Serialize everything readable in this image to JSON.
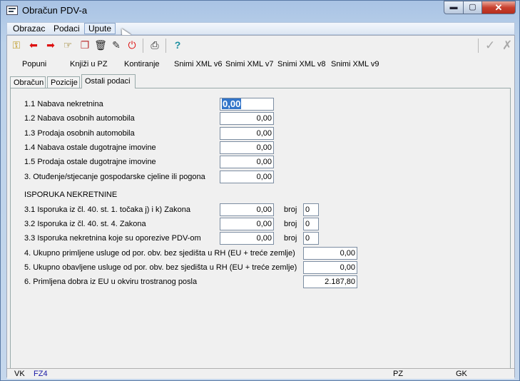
{
  "window": {
    "title": "Obračun PDV-a",
    "min_label": "▬",
    "max_label": "▢",
    "close_label": "✕"
  },
  "menu": {
    "items": [
      "Obrazac",
      "Podaci",
      "Upute"
    ]
  },
  "toolbar": {
    "icons": [
      "key-icon",
      "arrow-left-icon",
      "arrow-right-icon",
      "hand-point-icon",
      "copy-icon",
      "trash-icon",
      "edit-icon",
      "stop-icon",
      "print-icon",
      "help-icon"
    ],
    "help_label": "?"
  },
  "actions": {
    "popuni": "Popuni",
    "knjizi": "Knjiži u PZ",
    "kontiranje": "Kontiranje",
    "xml6": "Snimi XML v6",
    "xml7": "Snimi XML v7",
    "xml8": "Snimi XML v8",
    "xml9": "Snimi XML v9"
  },
  "tabs": [
    "Obračun",
    "Pozicije",
    "Ostali podaci"
  ],
  "form": {
    "r11": {
      "label": "1.1 Nabava nekretnina",
      "value": "0,00"
    },
    "r12": {
      "label": "1.2 Nabava osobnih automobila",
      "value": "0,00"
    },
    "r13": {
      "label": "1.3 Prodaja osobnih automobila",
      "value": "0,00"
    },
    "r14": {
      "label": "1.4 Nabava ostale dugotrajne imovine",
      "value": "0,00"
    },
    "r15": {
      "label": "1.5 Prodaja ostale dugotrajne imovine",
      "value": "0,00"
    },
    "r3": {
      "label": "3. Otuđenje/stjecanje gospodarske cjeline ili pogona",
      "value": "0,00"
    },
    "section": "ISPORUKA NEKRETNINE",
    "r31": {
      "label": "3.1 Isporuka iz čl. 40. st. 1. točaka j) i k) Zakona",
      "value": "0,00",
      "broj_label": "broj",
      "broj": "0"
    },
    "r32": {
      "label": "3.2 Isporuka iz čl. 40. st. 4. Zakona",
      "value": "0,00",
      "broj_label": "broj",
      "broj": "0"
    },
    "r33": {
      "label": "3.3 Isporuka nekretnina koje su oporezive PDV-om",
      "value": "0,00",
      "broj_label": "broj",
      "broj": "0"
    },
    "r4": {
      "label": "4. Ukupno primljene usluge od por. obv. bez sjedišta u RH (EU + treće zemlje)",
      "value": "0,00"
    },
    "r5": {
      "label": "5. Ukupno obavljene usluge od por. obv. bez sjedišta u RH (EU + treće zemlje)",
      "value": "0,00"
    },
    "r6": {
      "label": "6. Primljena dobra iz EU u okviru trostranog posla",
      "value": "2.187,80"
    }
  },
  "status": {
    "vk": "VK",
    "fz": "FZ4",
    "pz": "PZ",
    "gk": "GK"
  },
  "colors": {
    "title_bg": "#bcd2ea",
    "close_btn": "#c8412f",
    "selection": "#3375c9",
    "status_link": "#1a1aa6"
  }
}
